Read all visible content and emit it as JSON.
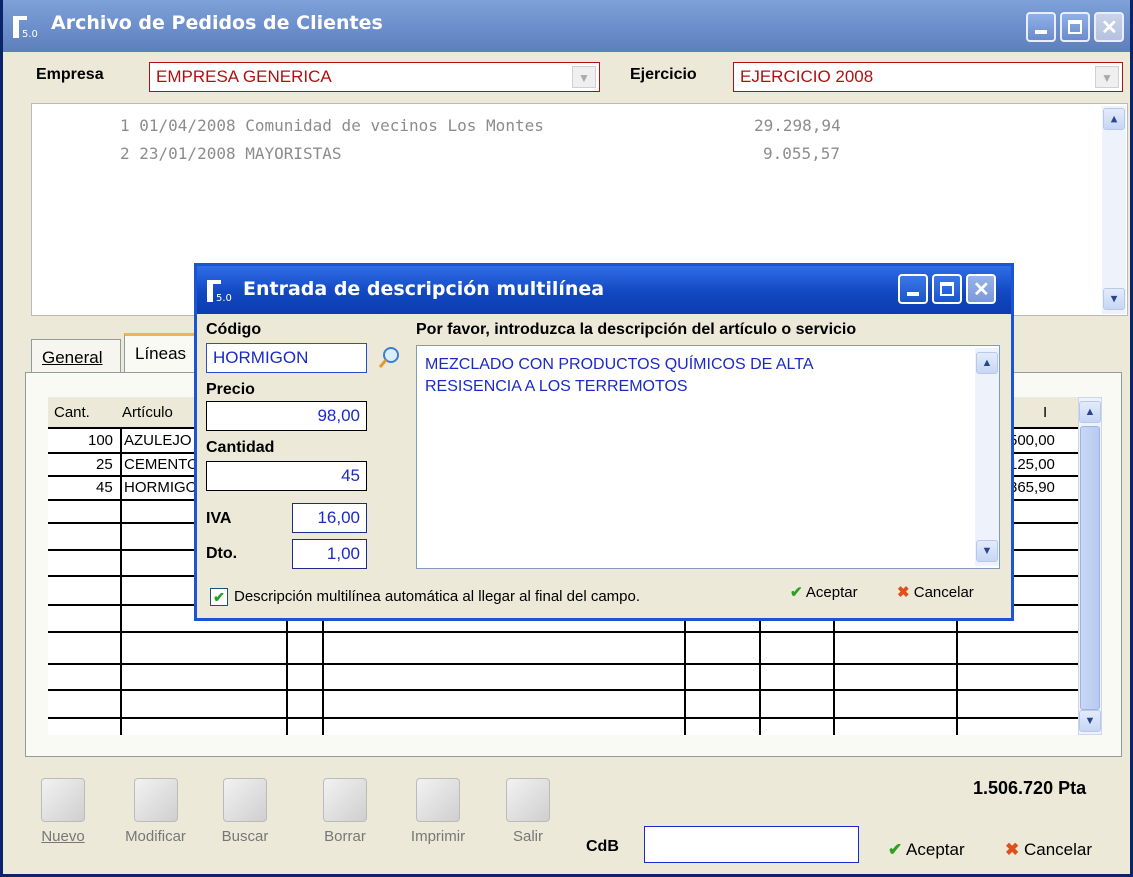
{
  "window": {
    "title": "Archivo de Pedidos de Clientes"
  },
  "header": {
    "empresa_label": "Empresa",
    "empresa_value": "EMPRESA GENERICA",
    "ejercicio_label": "Ejercicio",
    "ejercicio_value": "EJERCICIO 2008"
  },
  "orders": [
    {
      "text": "1 01/04/2008 Comunidad de vecinos Los Montes",
      "amount": "29.298,94"
    },
    {
      "text": "2 23/01/2008 MAYORISTAS",
      "amount": "9.055,57"
    }
  ],
  "tabs": [
    "General",
    "Líneas"
  ],
  "grid": {
    "headers": {
      "cant": "Cant.",
      "articulo": "Artículo",
      "last": "I"
    },
    "rows": [
      {
        "cant": "100",
        "articulo": "AZULEJO",
        "total": "500,00"
      },
      {
        "cant": "25",
        "articulo": "CEMENTO",
        "total": "125,00"
      },
      {
        "cant": "45",
        "articulo": "HORMIGO",
        "total": "365,90"
      }
    ]
  },
  "toolbar": [
    "Nuevo",
    "Modificar",
    "Buscar",
    "Borrar",
    "Imprimir",
    "Salir"
  ],
  "cdb_label": "CdB",
  "cdb_value": "",
  "total": "1.506.720 Pta",
  "main_buttons": {
    "accept": "Aceptar",
    "cancel": "Cancelar"
  },
  "dialog": {
    "title": "Entrada de descripción multilínea",
    "codigo_label": "Código",
    "codigo_value": "HORMIGON",
    "precio_label": "Precio",
    "precio_value": "98,00",
    "cantidad_label": "Cantidad",
    "cantidad_value": "45",
    "iva_label": "IVA",
    "iva_value": "16,00",
    "dto_label": "Dto.",
    "dto_value": "1,00",
    "desc_label": "Por favor, introduzca la descripción del artículo o servicio",
    "desc_line1": "MEZCLADO CON PRODUCTOS QUÍMICOS DE ALTA",
    "desc_line2": "RESISENCIA A LOS TERREMOTOS",
    "checkbox_label": "Descripción multilínea automática al llegar al final del campo.",
    "accept": "Aceptar",
    "cancel": "Cancelar"
  }
}
